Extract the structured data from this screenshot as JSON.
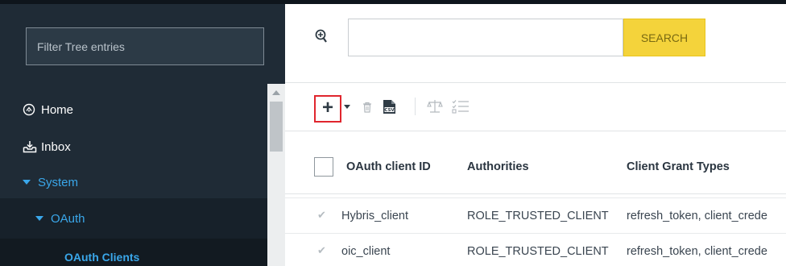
{
  "sidebar": {
    "filter_placeholder": "Filter Tree entries",
    "items": [
      {
        "label": "Home",
        "icon": "home-icon"
      },
      {
        "label": "Inbox",
        "icon": "inbox-icon"
      },
      {
        "label": "System",
        "icon": "caret-down-icon"
      },
      {
        "label": "OAuth",
        "icon": "caret-down-icon"
      },
      {
        "label": "OAuth Clients"
      }
    ],
    "colors": {
      "background": "#1f2b36",
      "active_text": "#3aa7ea"
    }
  },
  "search": {
    "value": "",
    "button_label": "SEARCH",
    "button_color": "#f4d33b"
  },
  "toolbar": {
    "add_icon": "plus-icon",
    "highlight_color": "#e0262e"
  },
  "table": {
    "columns": [
      "OAuth client ID",
      "Authorities",
      "Client Grant Types"
    ],
    "rows": [
      {
        "id": "Hybris_client",
        "authorities": "ROLE_TRUSTED_CLIENT",
        "grant_types": "refresh_token, client_crede"
      },
      {
        "id": "oic_client",
        "authorities": "ROLE_TRUSTED_CLIENT",
        "grant_types": "refresh_token, client_crede"
      }
    ]
  }
}
